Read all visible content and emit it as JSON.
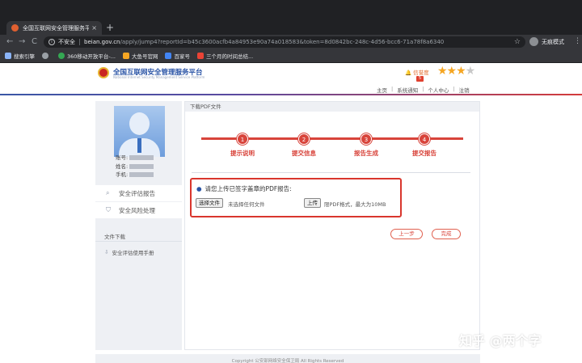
{
  "browser": {
    "tab_title": "全国互联网安全管理服务平台",
    "tab_close": "×",
    "new_tab": "+",
    "back": "←",
    "forward": "→",
    "reload": "C",
    "not_secure": "不安全",
    "url_host": "beian.gov.cn",
    "url_path": "/apply/jump4?reportId=b45c3600acfb4a84953e90a74a018583&token=8d0842bc-248c-4d56-bcc6-71a78f8a6340",
    "incognito_label": "无痕模式",
    "bookmarks": [
      {
        "label": "搜索引擎",
        "color": "#8ab4f8"
      },
      {
        "label": "",
        "color": "#9aa0a6"
      },
      {
        "label": "360移动开放平台-...",
        "color": "#34a853"
      },
      {
        "label": "大鱼号官网",
        "color": "#f5a623"
      },
      {
        "label": "百家号",
        "color": "#4285f4"
      },
      {
        "label": "三个月的时间总结...",
        "color": "#ea4335"
      }
    ]
  },
  "site": {
    "title": "全国互联网安全管理服务平台",
    "subtitle": "National Internet Security Management Service Platform",
    "credit_label": "信誉度",
    "credit_badge": "5",
    "stars_on": "★★★",
    "stars_off": "★",
    "nav": [
      "主页",
      "系统通知",
      "个人中心",
      "注销"
    ]
  },
  "sidebar": {
    "account_label": "账号:",
    "name_label": "姓名:",
    "phone_label": "手机:",
    "menu": [
      {
        "label": "安全评估报告",
        "icon": "search-icon"
      },
      {
        "label": "安全风险处理",
        "icon": "shield-icon"
      }
    ],
    "files_title": "文件下载",
    "file_item": "安全评估使用手册"
  },
  "main": {
    "panel_title": "下载PDF文件",
    "steps": [
      {
        "num": "1",
        "label": "提示说明"
      },
      {
        "num": "2",
        "label": "提交信息"
      },
      {
        "num": "3",
        "label": "报告生成"
      },
      {
        "num": "4",
        "label": "提交报告"
      }
    ],
    "upload_prompt": "请您上传已签字盖章的PDF报告:",
    "choose_file": "选择文件",
    "no_file": "未选择任何文件",
    "upload": "上传",
    "upload_hint": "限PDF格式，最大为10MB",
    "prev": "上一步",
    "done": "完成"
  },
  "footer": {
    "text": "Copyright 公安部网络安全保卫局 All Rights Reserved"
  },
  "watermark": "知乎 @两个字",
  "colors": {
    "accent_red": "#d8443b",
    "brand_blue": "#2a54a6",
    "chrome_dark": "#202124"
  }
}
